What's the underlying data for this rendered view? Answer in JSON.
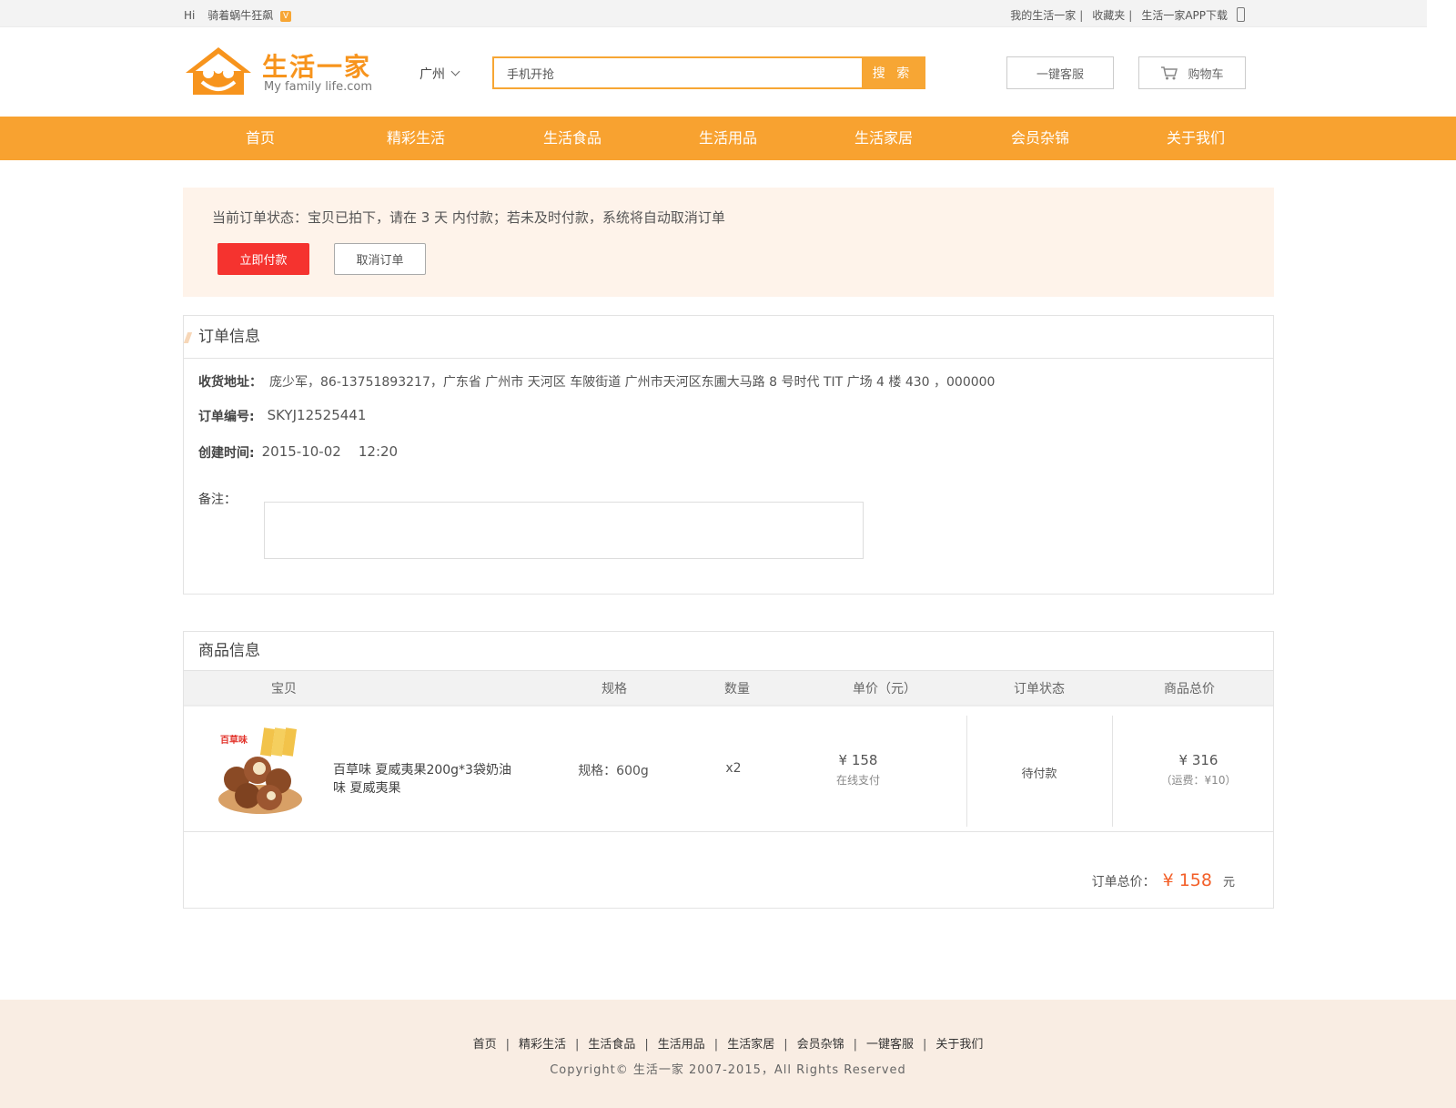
{
  "topbar": {
    "hi": "Hi",
    "username": "骑着蜗牛狂飙",
    "vip_badge": "V",
    "links": [
      "我的生活一家",
      "收藏夹",
      "生活一家APP下载"
    ],
    "separator": "|"
  },
  "header": {
    "logo_name": "生活一家",
    "logo_sub": "My family life.com",
    "city": "广州",
    "search_value": "手机开抢",
    "search_button": "搜 索",
    "service_button": "一键客服",
    "cart_button": "购物车"
  },
  "nav": {
    "items": [
      "首页",
      "精彩生活",
      "生活食品",
      "生活用品",
      "生活家居",
      "会员杂锦",
      "关于我们"
    ]
  },
  "status": {
    "message": "当前订单状态：宝贝已拍下，请在 3 天 内付款；若未及时付款，系统将自动取消订单",
    "pay_button": "立即付款",
    "cancel_button": "取消订单"
  },
  "order_info": {
    "title": "订单信息",
    "address_label": "收货地址：",
    "address_value": "庞少军，86-13751893217，广东省 广州市 天河区 车陂街道 广州市天河区东圃大马路 8 号时代 TIT 广场 4 楼 430 ，000000",
    "order_no_label": "订单编号:",
    "order_no_value": "SKYJ12525441",
    "created_label": "创建时间:",
    "created_value": "2015-10-02    12:20",
    "remark_label": "备注："
  },
  "goods": {
    "title": "商品信息",
    "columns": [
      "宝贝",
      "规格",
      "数量",
      "单价（元）",
      "订单状态",
      "商品总价"
    ],
    "items": [
      {
        "name": "百草味 夏威夷果200g*3袋奶油味  夏威夷果",
        "brand_label": "百草味",
        "spec": "规格：600g",
        "qty": "x2",
        "price": "¥ 158",
        "payment": "在线支付",
        "status": "待付款",
        "total": "¥ 316",
        "shipping": "（运费：¥10）"
      }
    ],
    "order_total_label": "订单总价：",
    "order_total_value": "¥ 158",
    "order_total_unit": "元"
  },
  "footer": {
    "links": [
      "首页",
      "精彩生活",
      "生活食品",
      "生活用品",
      "生活家居",
      "会员杂锦",
      "一键客服",
      "关于我们"
    ],
    "copyright": "Copyright© 生活一家 2007-2015，All Rights Reserved"
  },
  "colors": {
    "accent": "#f8a230",
    "pay_red": "#f5332f",
    "price_orange": "#f35f28",
    "status_bg": "#fef3ea",
    "footer_bg": "#f9ede3"
  },
  "icons": [
    "phone-icon",
    "chevron-down-icon",
    "cart-icon",
    "logo-house-icon"
  ]
}
